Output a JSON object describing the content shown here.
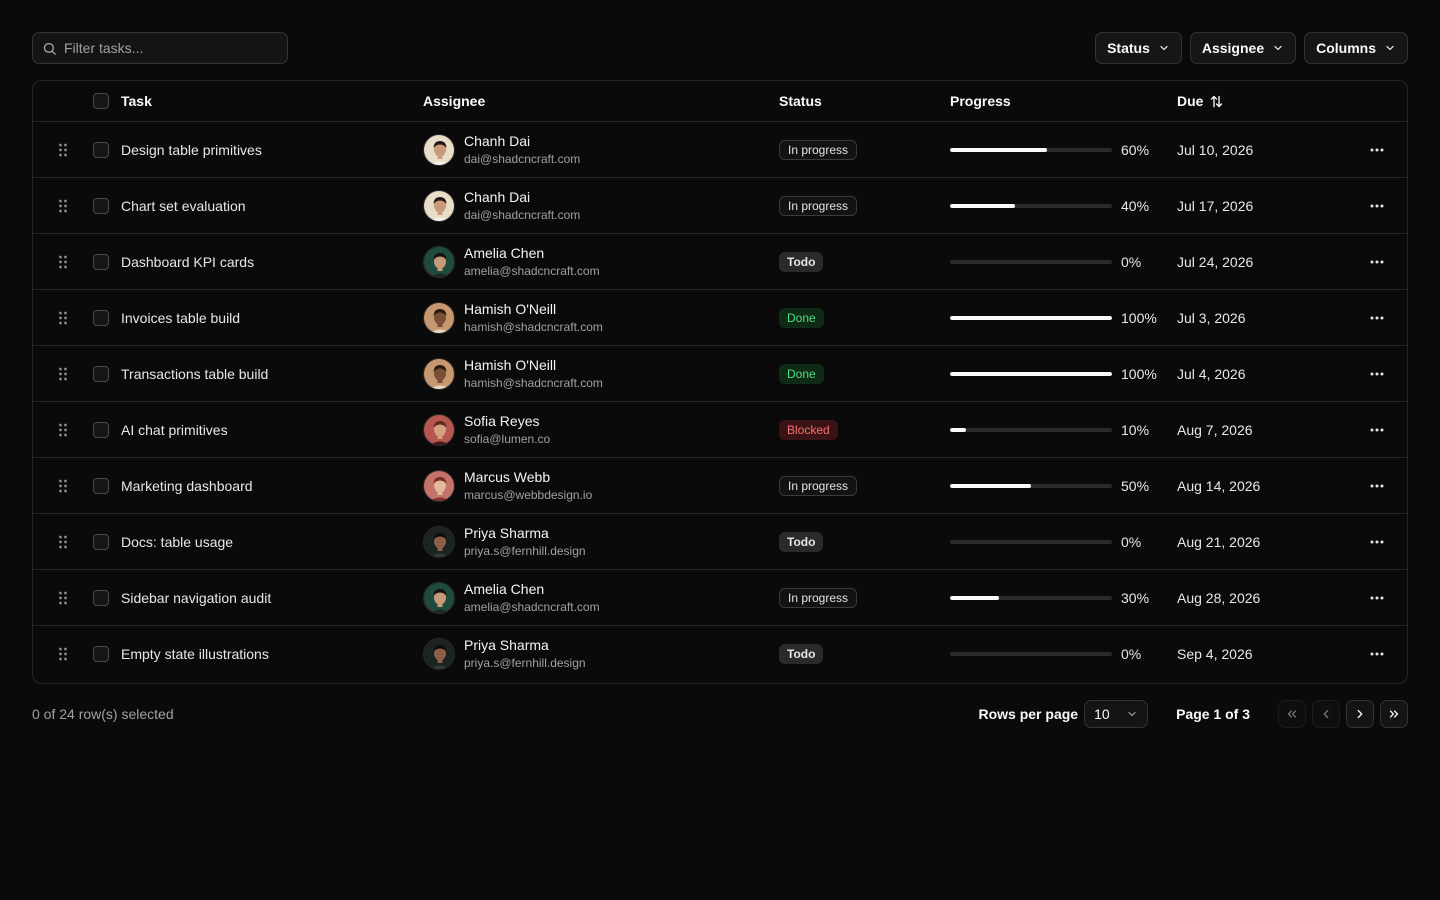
{
  "toolbar": {
    "search_placeholder": "Filter tasks...",
    "filters": [
      "Status",
      "Assignee",
      "Columns"
    ]
  },
  "table": {
    "columns": {
      "task": "Task",
      "assignee": "Assignee",
      "status": "Status",
      "progress": "Progress",
      "due": "Due"
    },
    "rows": [
      {
        "task": "Design table primitives",
        "name": "Chanh Dai",
        "email": "dai@shadcncraft.com",
        "avatar": "light",
        "status": "In progress",
        "status_kind": "progress",
        "progress": 60,
        "pct": "60%",
        "due": "Jul 10, 2026"
      },
      {
        "task": "Chart set evaluation",
        "name": "Chanh Dai",
        "email": "dai@shadcncraft.com",
        "avatar": "light",
        "status": "In progress",
        "status_kind": "progress",
        "progress": 40,
        "pct": "40%",
        "due": "Jul 17, 2026"
      },
      {
        "task": "Dashboard KPI cards",
        "name": "Amelia Chen",
        "email": "amelia@shadcncraft.com",
        "avatar": "green",
        "status": "Todo",
        "status_kind": "todo",
        "progress": 0,
        "pct": "0%",
        "due": "Jul 24, 2026"
      },
      {
        "task": "Invoices table build",
        "name": "Hamish O'Neill",
        "email": "hamish@shadcncraft.com",
        "avatar": "tan",
        "status": "Done",
        "status_kind": "done",
        "progress": 100,
        "pct": "100%",
        "due": "Jul 3, 2026"
      },
      {
        "task": "Transactions table build",
        "name": "Hamish O'Neill",
        "email": "hamish@shadcncraft.com",
        "avatar": "tan",
        "status": "Done",
        "status_kind": "done",
        "progress": 100,
        "pct": "100%",
        "due": "Jul 4, 2026"
      },
      {
        "task": "AI chat primitives",
        "name": "Sofia Reyes",
        "email": "sofia@lumen.co",
        "avatar": "rose",
        "status": "Blocked",
        "status_kind": "blocked",
        "progress": 10,
        "pct": "10%",
        "due": "Aug 7, 2026"
      },
      {
        "task": "Marketing dashboard",
        "name": "Marcus Webb",
        "email": "marcus@webbdesign.io",
        "avatar": "red",
        "status": "In progress",
        "status_kind": "progress",
        "progress": 50,
        "pct": "50%",
        "due": "Aug 14, 2026"
      },
      {
        "task": "Docs: table usage",
        "name": "Priya Sharma",
        "email": "priya.s@fernhill.design",
        "avatar": "dark",
        "status": "Todo",
        "status_kind": "todo",
        "progress": 0,
        "pct": "0%",
        "due": "Aug 21, 2026"
      },
      {
        "task": "Sidebar navigation audit",
        "name": "Amelia Chen",
        "email": "amelia@shadcncraft.com",
        "avatar": "green",
        "status": "In progress",
        "status_kind": "progress",
        "progress": 30,
        "pct": "30%",
        "due": "Aug 28, 2026"
      },
      {
        "task": "Empty state illustrations",
        "name": "Priya Sharma",
        "email": "priya.s@fernhill.design",
        "avatar": "dark",
        "status": "Todo",
        "status_kind": "todo",
        "progress": 0,
        "pct": "0%",
        "due": "Sep 4, 2026"
      }
    ]
  },
  "footer": {
    "selection": "0 of 24 row(s) selected",
    "rows_per_page_label": "Rows per page",
    "rows_per_page_value": "10",
    "page_info": "Page 1 of 3"
  },
  "avatar_palettes": {
    "light": {
      "bg": "#e9dcc8",
      "skin": "#c89a78",
      "hair": "#1d1a17",
      "shirt": "#f1f1f1"
    },
    "green": {
      "bg": "#1f4a3e",
      "skin": "#c79a7a",
      "hair": "#15110e",
      "shirt": "#1c2a27"
    },
    "tan": {
      "bg": "#c79770",
      "skin": "#7a4f35",
      "hair": "#2a1a12",
      "shirt": "#e6d5c0"
    },
    "rose": {
      "bg": "#b5574f",
      "skin": "#d4a080",
      "hair": "#5a2a1c",
      "shirt": "#3b1c1a"
    },
    "red": {
      "bg": "#c4736a",
      "skin": "#e2b89a",
      "hair": "#7b2f22",
      "shirt": "#7d3329"
    },
    "dark": {
      "bg": "#1c2420",
      "skin": "#8a6046",
      "hair": "#0f0c0a",
      "shirt": "#2d3b34"
    }
  },
  "colors": {
    "background": "#0a0a0a",
    "border": "#262626",
    "muted_text": "#a1a1a1",
    "done": "#4ade80",
    "blocked": "#f87171"
  }
}
